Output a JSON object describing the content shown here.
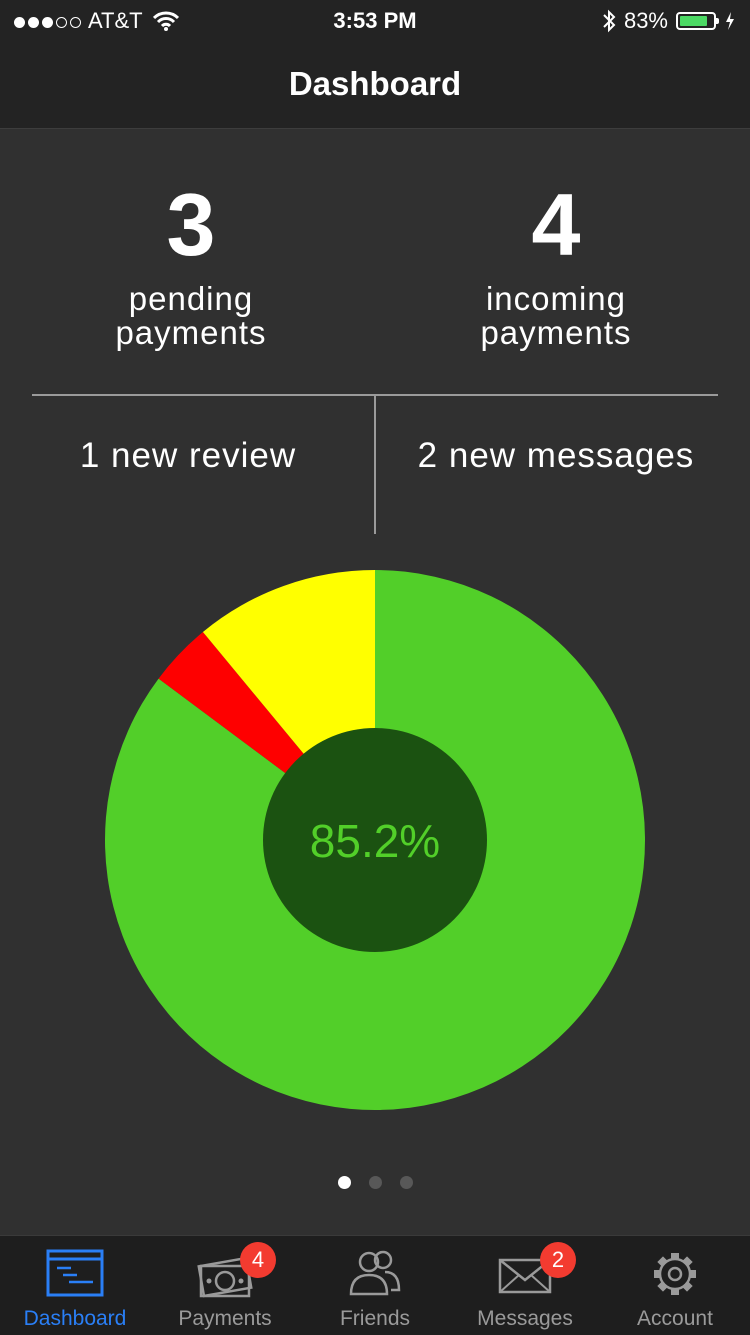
{
  "status_bar": {
    "carrier": "AT&T",
    "time": "3:53 PM",
    "battery_percent": "83%",
    "battery_level": 0.83,
    "signal_dots_filled": 3,
    "signal_dots_total": 5,
    "icons": [
      "wifi-icon",
      "bluetooth-icon",
      "battery-icon",
      "charging-icon"
    ]
  },
  "header": {
    "title": "Dashboard"
  },
  "stats": [
    {
      "value": "3",
      "label": "pending\npayments"
    },
    {
      "value": "4",
      "label": "incoming\npayments"
    }
  ],
  "notifications": {
    "reviews": "1 new review",
    "messages": "2 new messages"
  },
  "chart_data": {
    "type": "pie",
    "center_label": "85.2%",
    "slices": [
      {
        "value": 85.2,
        "color": "#52cf29"
      },
      {
        "value": 3.8,
        "color": "#fe0000"
      },
      {
        "value": 11.0,
        "color": "#ffff00"
      }
    ]
  },
  "pager": {
    "count": 3,
    "active_index": 0
  },
  "tabbar": {
    "items": [
      {
        "label": "Dashboard",
        "icon": "dashboard-icon",
        "active": true,
        "badge": ""
      },
      {
        "label": "Payments",
        "icon": "money-icon",
        "active": false,
        "badge": "4"
      },
      {
        "label": "Friends",
        "icon": "friends-icon",
        "active": false,
        "badge": ""
      },
      {
        "label": "Messages",
        "icon": "envelope-icon",
        "active": false,
        "badge": "2"
      },
      {
        "label": "Account",
        "icon": "gear-icon",
        "active": false,
        "badge": ""
      }
    ]
  },
  "colors": {
    "accent": "#2a7ff6",
    "badge": "#f33b30",
    "center_disc": "#1b5211",
    "center_text": "#52cf29"
  }
}
